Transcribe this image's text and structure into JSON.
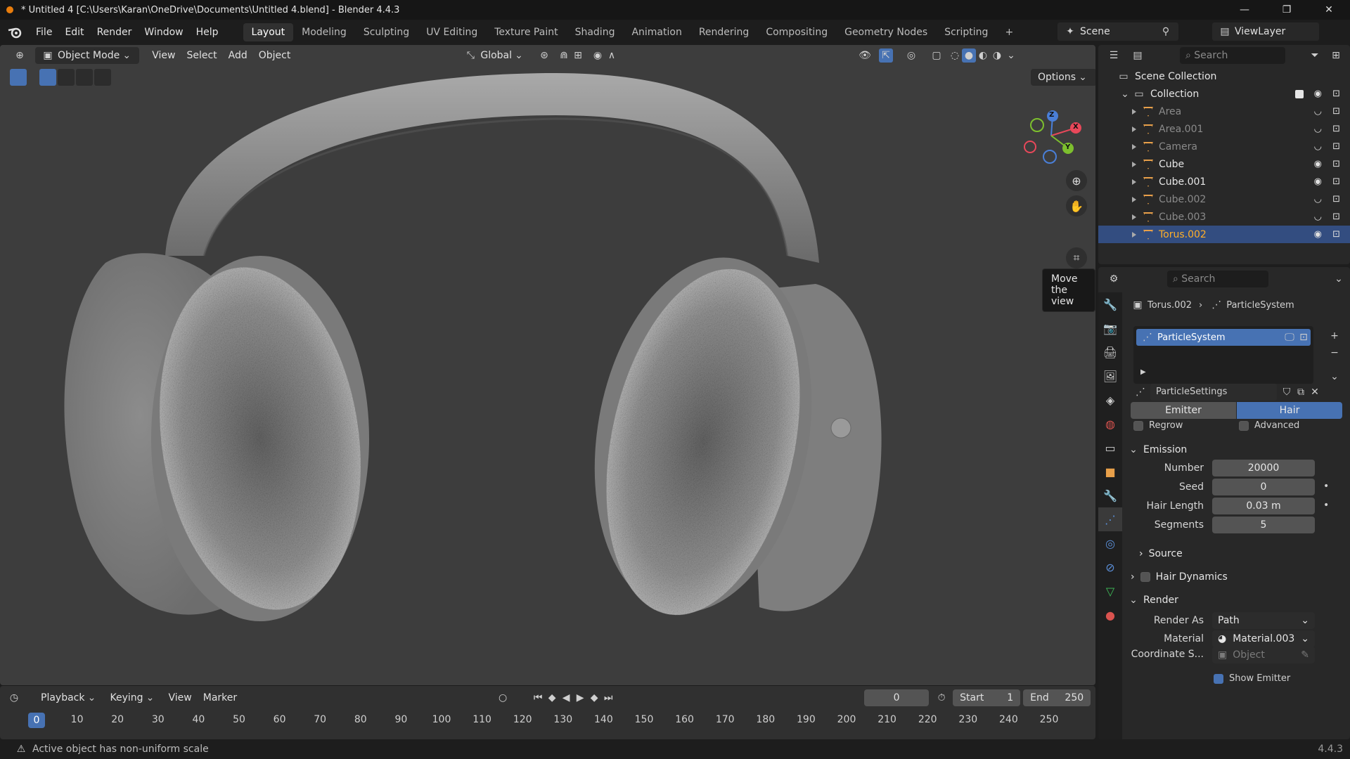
{
  "window": {
    "title": "* Untitled 4 [C:\\Users\\Karan\\OneDrive\\Documents\\Untitled 4.blend] - Blender 4.4.3",
    "minimize": "—",
    "maximize": "❐",
    "close": "✕"
  },
  "menu": {
    "items": [
      "File",
      "Edit",
      "Render",
      "Window",
      "Help"
    ],
    "workspaces": [
      "Layout",
      "Modeling",
      "Sculpting",
      "UV Editing",
      "Texture Paint",
      "Shading",
      "Animation",
      "Rendering",
      "Compositing",
      "Geometry Nodes",
      "Scripting"
    ],
    "active_workspace": "Layout",
    "add_workspace": "+",
    "scene": "Scene",
    "view_layer": "ViewLayer"
  },
  "viewport": {
    "mode": "Object Mode",
    "menus": [
      "View",
      "Select",
      "Add",
      "Object"
    ],
    "orientation": "Global",
    "options": "Options",
    "tooltip": "Move the view",
    "gizmo": {
      "z": "Z",
      "x": "X",
      "y": "Y"
    }
  },
  "timeline": {
    "menus": [
      "Playback",
      "Keying",
      "View",
      "Marker"
    ],
    "current_frame": "0",
    "start_label": "Start",
    "start": "1",
    "end_label": "End",
    "end": "250",
    "ticks": [
      "0",
      "10",
      "20",
      "30",
      "40",
      "50",
      "60",
      "70",
      "80",
      "90",
      "100",
      "110",
      "120",
      "130",
      "140",
      "150",
      "160",
      "170",
      "180",
      "190",
      "200",
      "210",
      "220",
      "230",
      "240",
      "250"
    ]
  },
  "status": {
    "message": "Active object has non-uniform scale",
    "version": "4.4.3"
  },
  "outliner": {
    "search_placeholder": "Search",
    "scene_collection": "Scene Collection",
    "collection": "Collection",
    "items": [
      {
        "name": "Area",
        "visible": false
      },
      {
        "name": "Area.001",
        "visible": false
      },
      {
        "name": "Camera",
        "visible": false
      },
      {
        "name": "Cube",
        "visible": true
      },
      {
        "name": "Cube.001",
        "visible": true
      },
      {
        "name": "Cube.002",
        "visible": false
      },
      {
        "name": "Cube.003",
        "visible": false
      },
      {
        "name": "Torus.002",
        "visible": true,
        "active": true
      }
    ]
  },
  "properties": {
    "search_placeholder": "Search",
    "breadcrumb_object": "Torus.002",
    "breadcrumb_system": "ParticleSystem",
    "system_list_item": "ParticleSystem",
    "settings_name": "ParticleSettings",
    "type_emitter": "Emitter",
    "type_hair": "Hair",
    "regrow": "Regrow",
    "advanced": "Advanced",
    "emission": {
      "header": "Emission",
      "number_label": "Number",
      "number": "20000",
      "seed_label": "Seed",
      "seed": "0",
      "hair_length_label": "Hair Length",
      "hair_length": "0.03 m",
      "segments_label": "Segments",
      "segments": "5",
      "source": "Source"
    },
    "hair_dynamics": "Hair Dynamics",
    "render": {
      "header": "Render",
      "render_as_label": "Render As",
      "render_as": "Path",
      "material_label": "Material",
      "material": "Material.003",
      "coord_label": "Coordinate S...",
      "coord_placeholder": "Object",
      "show_emitter": "Show Emitter"
    }
  }
}
